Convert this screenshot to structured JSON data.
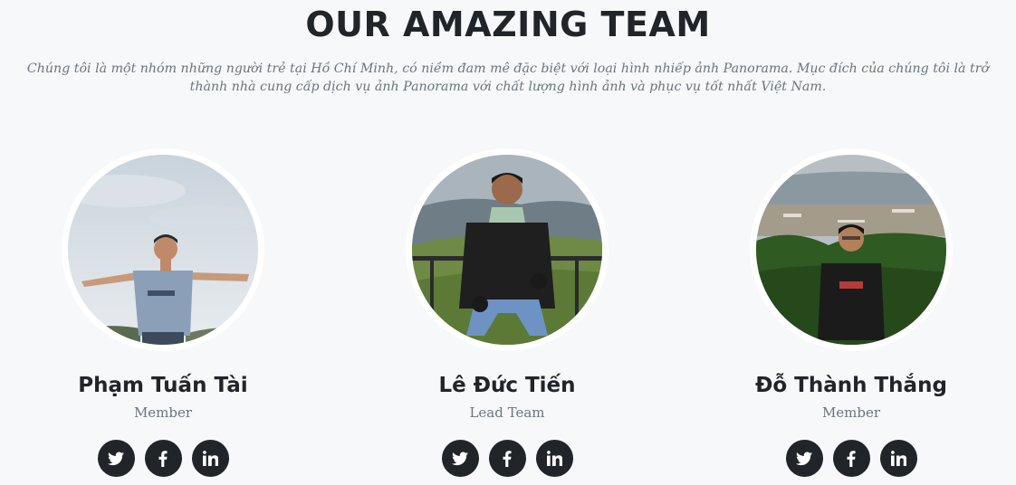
{
  "section": {
    "title": "OUR AMAZING TEAM",
    "subtitle": "Chúng tôi là một nhóm những người trẻ tại Hồ Chí Minh, có niềm đam mê đặc biệt với loại hình nhiếp ảnh Panorama. Mục đích của chúng tôi là trở thành nhà cung cấp dịch vụ ảnh Panorama với chất lượng hình ảnh và phục vụ tốt nhất Việt Nam."
  },
  "members": [
    {
      "name": "Phạm Tuấn Tài",
      "role": "Member",
      "social": [
        "twitter-icon",
        "facebook-icon",
        "linkedin-icon"
      ]
    },
    {
      "name": "Lê Đức Tiến",
      "role": "Lead Team",
      "social": [
        "twitter-icon",
        "facebook-icon",
        "linkedin-icon"
      ]
    },
    {
      "name": "Đỗ Thành Thắng",
      "role": "Member",
      "social": [
        "twitter-icon",
        "facebook-icon",
        "linkedin-icon"
      ]
    }
  ],
  "colors": {
    "background": "#f7f8fa",
    "heading": "#212529",
    "muted": "#6c757d",
    "social_button": "#212529"
  }
}
